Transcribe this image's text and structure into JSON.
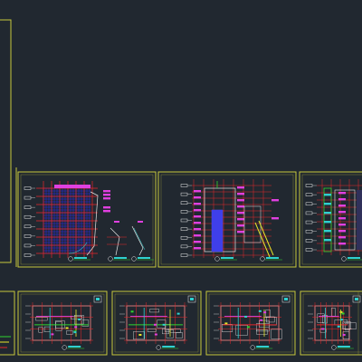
{
  "app": {
    "view": "model-space",
    "background_color": "#212830",
    "sheet_border_color": "#c8c83c"
  },
  "drawing": {
    "colors": {
      "red": "#e8262a",
      "blue": "#2a2ae6",
      "white": "#e6e6e6",
      "magenta": "#e040e0",
      "green": "#2fd52f",
      "cyan": "#2fd0d0",
      "yellow": "#e6e62a"
    },
    "sheets": [
      {
        "id": "frame-left-tall",
        "kind": "empty"
      },
      {
        "id": "frame-left-small",
        "kind": "empty"
      },
      {
        "id": "sheet-1",
        "kind": "plan-a"
      },
      {
        "id": "sheet-2",
        "kind": "plan-b"
      },
      {
        "id": "sheet-3",
        "kind": "plan-c"
      },
      {
        "id": "sheet-4",
        "kind": "floor-plan"
      },
      {
        "id": "sheet-5",
        "kind": "floor-plan"
      },
      {
        "id": "sheet-6",
        "kind": "floor-plan"
      },
      {
        "id": "sheet-7",
        "kind": "floor-plan"
      },
      {
        "id": "sheet-8",
        "kind": "floor-plan"
      }
    ]
  }
}
